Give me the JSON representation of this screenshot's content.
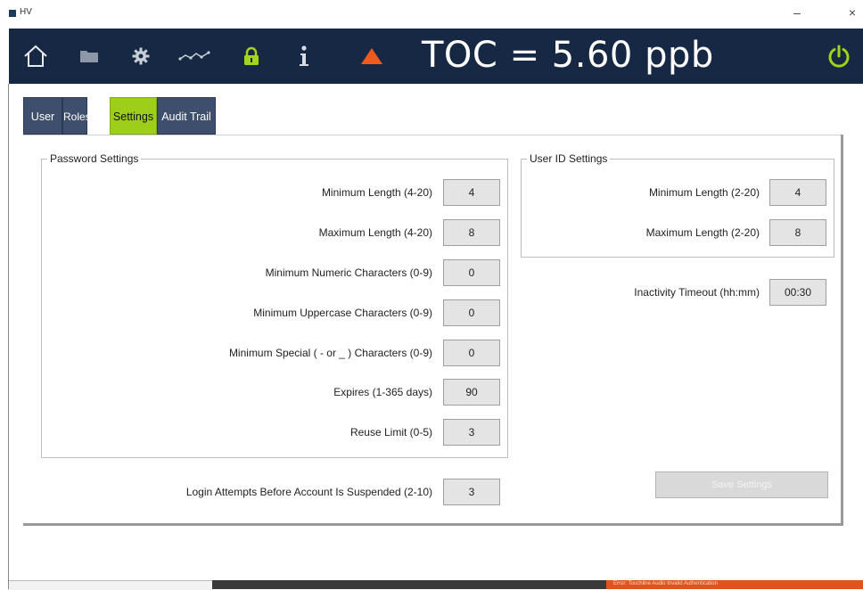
{
  "window": {
    "title": "HV",
    "minimize_glyph": "–",
    "close_glyph": "×"
  },
  "toolbar": {
    "icons": [
      "home-icon",
      "folder-icon",
      "gear-icon",
      "trend-icon",
      "lock-icon",
      "info-icon",
      "alert-icon",
      "power-icon"
    ],
    "toc_reading": "TOC = 5.60 ppb",
    "colors": {
      "bar": "#172845",
      "lock": "#a6d41a",
      "alert": "#f05a1c",
      "power": "#9fd31a"
    }
  },
  "tabs": [
    {
      "label": "User List"
    },
    {
      "label": "Roles"
    },
    {
      "label": "Settings",
      "active": true
    },
    {
      "label": "Audit Trail"
    }
  ],
  "password_settings": {
    "title": "Password Settings",
    "rows": [
      {
        "label": "Minimum  Length (4-20)",
        "value": "4"
      },
      {
        "label": "Maximum Length (4-20)",
        "value": "8"
      },
      {
        "label": "Minimum Numeric Characters (0-9)",
        "value": "0"
      },
      {
        "label": "Minimum Uppercase Characters (0-9)",
        "value": "0"
      },
      {
        "label": "Minimum Special ( -  or _ ) Characters (0-9)",
        "value": "0"
      },
      {
        "label": "Expires (1-365 days)",
        "value": "90"
      },
      {
        "label": "Reuse Limit (0-5)",
        "value": "3"
      }
    ]
  },
  "login_attempts": {
    "label": "Login Attempts Before Account Is Suspended (2-10)",
    "value": "3"
  },
  "user_id_settings": {
    "title": "User ID Settings",
    "rows": [
      {
        "label": "Minimum Length (2-20)",
        "value": "4"
      },
      {
        "label": "Maximum Length (2-20)",
        "value": "8"
      }
    ]
  },
  "inactivity": {
    "label": "Inactivity Timeout (hh:mm)",
    "value": "00:30"
  },
  "save_button": {
    "label": "Save Settings"
  },
  "bottom_strip": {
    "notification": "Error: Touchline Audio Invalid Authentication"
  }
}
